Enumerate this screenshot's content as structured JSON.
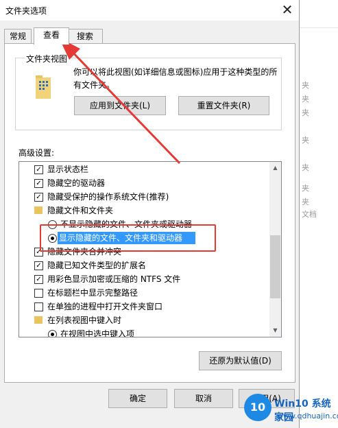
{
  "window": {
    "title": "文件夹选项",
    "close_glyph": "✕"
  },
  "tabs": [
    {
      "label": "常规"
    },
    {
      "label": "查看",
      "active": true
    },
    {
      "label": "搜索"
    }
  ],
  "folder_view": {
    "title": "文件夹视图",
    "description": "你可以将此视图(如详细信息或图标)应用于这种类型的所有文件夹。",
    "apply_button": "应用到文件夹(L)",
    "reset_button": "重置文件夹(R)"
  },
  "advanced": {
    "label": "高级设置:",
    "items": [
      {
        "type": "checkbox",
        "checked": true,
        "label": "显示状态栏"
      },
      {
        "type": "checkbox",
        "checked": true,
        "label": "隐藏空的驱动器"
      },
      {
        "type": "checkbox",
        "checked": true,
        "label": "隐藏受保护的操作系统文件(推荐)"
      },
      {
        "type": "folder",
        "label": "隐藏文件和文件夹"
      },
      {
        "type": "radio",
        "checked": false,
        "label": "不显示隐藏的文件、文件夹或驱动器"
      },
      {
        "type": "radio",
        "checked": true,
        "label": "显示隐藏的文件、文件夹和驱动器"
      },
      {
        "type": "checkbox",
        "checked": true,
        "label": "隐藏文件夹合并冲突"
      },
      {
        "type": "checkbox",
        "checked": true,
        "label": "隐藏已知文件类型的扩展名"
      },
      {
        "type": "checkbox",
        "checked": true,
        "label": "用彩色显示加密或压缩的 NTFS 文件"
      },
      {
        "type": "checkbox",
        "checked": false,
        "label": "在标题栏中显示完整路径"
      },
      {
        "type": "checkbox",
        "checked": false,
        "label": "在单独的进程中打开文件夹窗口"
      },
      {
        "type": "folder",
        "label": "在列表视图中键入时"
      },
      {
        "type": "radio",
        "checked": true,
        "label": "在视图中选中键入项"
      }
    ],
    "restore_button": "还原为默认值(D)"
  },
  "footer": {
    "ok": "确定",
    "cancel": "取消",
    "apply": "应用(A)"
  },
  "background": {
    "chars": [
      "夹",
      "夹",
      "夹",
      "夹",
      "夹",
      "夹",
      "夹",
      "文档"
    ]
  },
  "watermark": {
    "logo": "10",
    "title": "Win10 系统家园",
    "url": "www.qdhuajin.com"
  },
  "colors": {
    "selection": "#3399ff",
    "annotation": "#e53935",
    "folder": "#e8c460"
  }
}
